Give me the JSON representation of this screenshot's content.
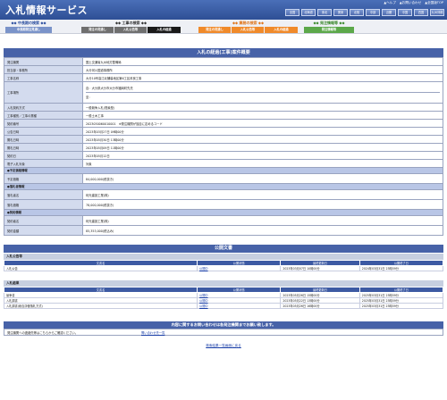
{
  "header": {
    "logo": "入札情報サービス",
    "top_links": [
      "▲ヘルプ",
      "▲お問い合わせ",
      "▲全国版TOP"
    ],
    "regions": [
      "全国",
      "北海道",
      "東北",
      "関東",
      "北陸",
      "中部",
      "近畿",
      "中国",
      "四国",
      "九州沖縄"
    ]
  },
  "menu": {
    "blue": {
      "label": "◆◆ 中長期の検索 ◆◆",
      "buttons": [
        "中長期発注見通し"
      ]
    },
    "gray": {
      "label": "◆◆ 工事の検索 ◆◆",
      "buttons": [
        "発注の見通し",
        "入札公告等",
        "入札の経過"
      ],
      "active": 2
    },
    "orange": {
      "label": "◆◆ 業務の検索 ◆◆",
      "buttons": [
        "発注の見通し",
        "入札公告等",
        "入札の経過"
      ]
    },
    "green": {
      "label": "◆◆ 発注情報等 ◆◆",
      "buttons": [
        "発注情報等"
      ]
    }
  },
  "detail": {
    "title": "入札の経過(工事)案件概要",
    "rows": [
      {
        "label": "発注機関",
        "value": "国土交通省九州地方整備局"
      },
      {
        "label": "担当部・事務所",
        "value": "大分河川国道事務所"
      },
      {
        "label": "工事名称",
        "value": "大分10号高江北舗装地区第6工区改良工事"
      },
      {
        "label": "工事場所",
        "value": "自：大分県大分市大分市福岡町先先",
        "value2": "至："
      },
      {
        "label": "入札契約方式",
        "value": "一般競争入札(簡素型)"
      },
      {
        "label": "工事種別／工事の業種",
        "value": "一般土木工事"
      },
      {
        "label": "契約番号",
        "value": "2023050060010001　※発注機関が独自に定めるコード"
      },
      {
        "label": "公告日時",
        "value": "2023年03月27日 09時00分"
      },
      {
        "label": "開札日時",
        "value": "2023年05月30日 13時00分"
      },
      {
        "label": "開札日時",
        "value": "2023年05月09日 11時00分"
      },
      {
        "label": "契約日",
        "value": "2023年05月12日"
      },
      {
        "label": "電子入札対象",
        "value": "対象"
      }
    ],
    "estimate_header": "●予定価格情報",
    "estimate_rows": [
      {
        "label": "予定価格",
        "value": "84,000,000(税抜き)"
      }
    ],
    "winner_header": "●落札者情報",
    "winner_rows": [
      {
        "label": "落札者名",
        "value": "利光建設工業(株)"
      },
      {
        "label": "落札価格",
        "value": "78,000,000(税抜き)"
      }
    ],
    "contract_header": "●契約情報",
    "contract_rows": [
      {
        "label": "契約者名",
        "value": "利光建設工業(株)"
      },
      {
        "label": "契約金額",
        "value": "85,353,000(税込み)"
      }
    ]
  },
  "documents": {
    "title": "公開文書",
    "columns": [
      "文書名",
      "公開状態",
      "最終更新日",
      "公開終了日"
    ],
    "groups": [
      {
        "name": "入札公告等",
        "rows": [
          {
            "doc": "入札公告",
            "state": "公開中",
            "updated": "2023年03月07日 10時00分",
            "end": "2024年03月31日 23時59分"
          }
        ]
      },
      {
        "name": "入札結果",
        "rows": [
          {
            "doc": "競争書",
            "state": "公開中",
            "updated": "2023年05月26日 15時00分",
            "end": "2025年03月31日 23時59分"
          },
          {
            "doc": "入札調書",
            "state": "公開中",
            "updated": "2023年05月22日 13時00分",
            "end": "2025年03月31日 23時59分"
          },
          {
            "doc": "入札調書(総合評価落札方式)",
            "state": "公開中",
            "updated": "2023年05月26日 16時00分",
            "end": "2025年03月31日 23時59分"
          }
        ]
      }
    ]
  },
  "contact": {
    "title": "内容に関するお問い合わせは各発注機関までお願い致します。",
    "text": "発注機関への連絡先等はこちらからご確認ください。",
    "link": "問い合わせ先一覧"
  },
  "back_link": "検索結果一覧画面に戻る",
  "colors": {
    "header": "#3b5ca8",
    "section": "#4762a8",
    "label_bg": "#d3dbee"
  }
}
